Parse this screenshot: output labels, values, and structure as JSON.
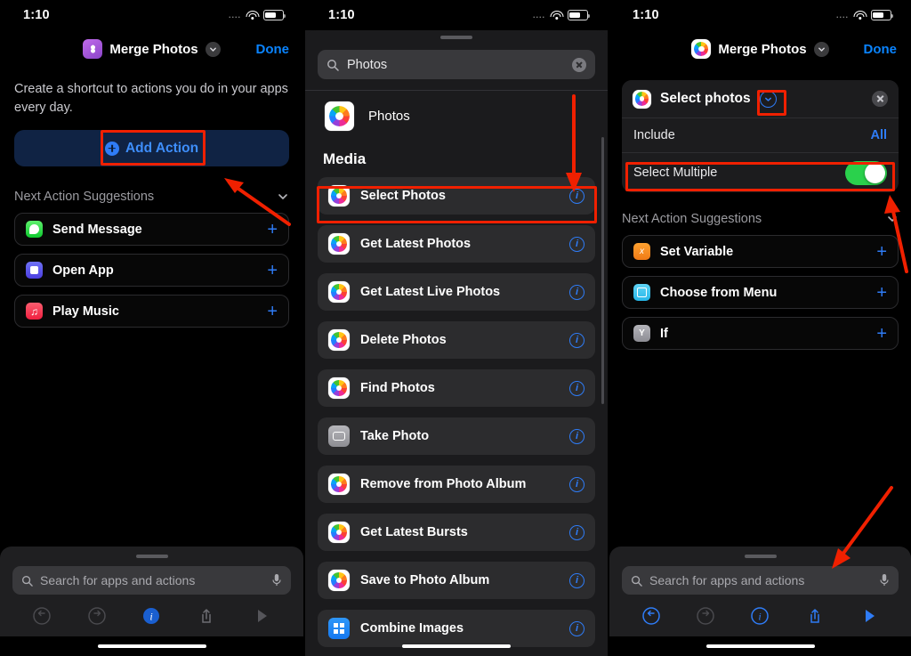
{
  "status_bar": {
    "time": "1:10",
    "signal": "....",
    "wifi": "wifi-icon",
    "battery": "battery-icon"
  },
  "panel1": {
    "nav": {
      "app_icon": "shortcuts-icon",
      "title": "Merge Photos",
      "chevron": "chevron-down-icon",
      "done_label": "Done"
    },
    "description": "Create a shortcut to actions you do in your apps every day.",
    "add_action_label": "Add Action",
    "add_action_icon": "plus-circle-icon",
    "suggestions_header": "Next Action Suggestions",
    "suggestions": [
      {
        "label": "Send Message",
        "icon": "messages-icon",
        "add": "+"
      },
      {
        "label": "Open App",
        "icon": "open-app-icon",
        "add": "+"
      },
      {
        "label": "Play Music",
        "icon": "music-icon",
        "add": "+"
      }
    ],
    "search_placeholder": "Search for apps and actions",
    "toolbar": [
      "undo-icon",
      "redo-icon",
      "info-icon",
      "share-icon",
      "play-icon"
    ]
  },
  "panel2": {
    "search_value": "Photos",
    "search_clear": "clear-icon",
    "app_result": {
      "label": "Photos",
      "icon": "photos-icon"
    },
    "section_title": "Media",
    "actions": [
      {
        "label": "Select Photos",
        "icon": "photos-icon",
        "info": "i"
      },
      {
        "label": "Get Latest Photos",
        "icon": "photos-icon",
        "info": "i"
      },
      {
        "label": "Get Latest Live Photos",
        "icon": "photos-icon",
        "info": "i"
      },
      {
        "label": "Delete Photos",
        "icon": "photos-icon",
        "info": "i"
      },
      {
        "label": "Find Photos",
        "icon": "photos-icon",
        "info": "i"
      },
      {
        "label": "Take Photo",
        "icon": "camera-icon",
        "info": "i"
      },
      {
        "label": "Remove from Photo Album",
        "icon": "photos-icon",
        "info": "i"
      },
      {
        "label": "Get Latest Bursts",
        "icon": "photos-icon",
        "info": "i"
      },
      {
        "label": "Save to Photo Album",
        "icon": "photos-icon",
        "info": "i"
      },
      {
        "label": "Combine Images",
        "icon": "combine-images-icon",
        "info": "i"
      }
    ]
  },
  "panel3": {
    "nav": {
      "app_icon": "photos-icon",
      "title": "Merge Photos",
      "chevron": "chevron-down-icon",
      "done_label": "Done"
    },
    "action_card": {
      "icon": "photos-icon",
      "title": "Select photos",
      "expand_icon": "chevron-down-circle-icon",
      "close_icon": "close-icon",
      "rows": [
        {
          "label": "Include",
          "value": "All",
          "type": "value"
        },
        {
          "label": "Select Multiple",
          "value": "on",
          "type": "toggle"
        }
      ]
    },
    "suggestions_header": "Next Action Suggestions",
    "suggestions": [
      {
        "label": "Set Variable",
        "icon": "set-variable-icon",
        "add": "+"
      },
      {
        "label": "Choose from Menu",
        "icon": "choose-from-menu-icon",
        "add": "+"
      },
      {
        "label": "If",
        "icon": "if-icon",
        "add": "+"
      }
    ],
    "search_placeholder": "Search for apps and actions",
    "toolbar": [
      "undo-icon",
      "redo-icon",
      "info-icon",
      "share-icon",
      "play-icon"
    ]
  },
  "annotations": {
    "highlight_color": "#f02000",
    "count": 6
  }
}
